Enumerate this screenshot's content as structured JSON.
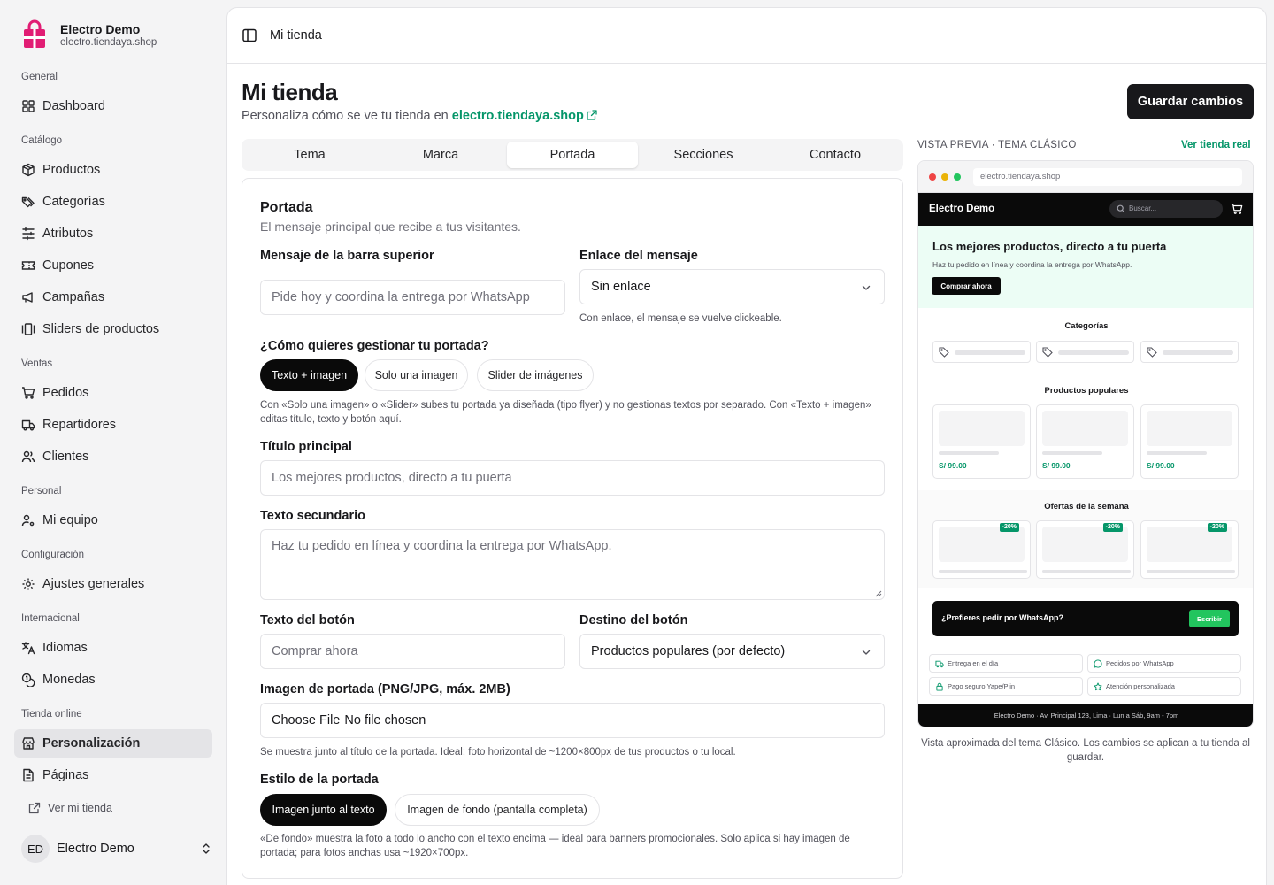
{
  "sidebar": {
    "brand": {
      "name": "Electro Demo",
      "domain": "electro.tiendaya.shop",
      "logo_color": "#e11d74"
    },
    "groups": {
      "general": "General",
      "catalogo": "Catálogo",
      "ventas": "Ventas",
      "personal": "Personal",
      "configuracion": "Configuración",
      "internacional": "Internacional",
      "tienda_online": "Tienda online"
    },
    "items": {
      "dashboard": "Dashboard",
      "productos": "Productos",
      "categorias": "Categorías",
      "atributos": "Atributos",
      "cupones": "Cupones",
      "campanas": "Campañas",
      "sliders": "Sliders de productos",
      "pedidos": "Pedidos",
      "repartidores": "Repartidores",
      "clientes": "Clientes",
      "equipo": "Mi equipo",
      "ajustes": "Ajustes generales",
      "idiomas": "Idiomas",
      "monedas": "Monedas",
      "personalizacion": "Personalización",
      "paginas": "Páginas"
    },
    "view_store": "Ver mi tienda",
    "user": {
      "initials": "ED",
      "name": "Electro Demo"
    }
  },
  "topbar": {
    "breadcrumb": "Mi tienda"
  },
  "page": {
    "title": "Mi tienda",
    "subtitle_prefix": "Personaliza cómo se ve tu tienda en",
    "subtitle_link": "electro.tiendaya.shop",
    "save_label": "Guardar cambios"
  },
  "tabs": [
    "Tema",
    "Marca",
    "Portada",
    "Secciones",
    "Contacto"
  ],
  "active_tab": "Portada",
  "form": {
    "section_title": "Portada",
    "section_desc": "El mensaje principal que recibe a tus visitantes.",
    "topbar_msg": {
      "label": "Mensaje de la barra superior",
      "placeholder": "Pide hoy y coordina la entrega por WhatsApp"
    },
    "msg_link": {
      "label": "Enlace del mensaje",
      "value": "Sin enlace",
      "help": "Con enlace, el mensaje se vuelve clickeable."
    },
    "manage": {
      "label": "¿Cómo quieres gestionar tu portada?",
      "options": [
        "Texto + imagen",
        "Solo una imagen",
        "Slider de imágenes"
      ],
      "selected": "Texto + imagen",
      "help": "Con «Solo una imagen» o «Slider» subes tu portada ya diseñada (tipo flyer) y no gestionas textos por separado. Con «Texto + imagen» editas título, texto y botón aquí."
    },
    "main_title": {
      "label": "Título principal",
      "placeholder": "Los mejores productos, directo a tu puerta"
    },
    "secondary_text": {
      "label": "Texto secundario",
      "placeholder": "Haz tu pedido en línea y coordina la entrega por WhatsApp."
    },
    "button_text": {
      "label": "Texto del botón",
      "placeholder": "Comprar ahora"
    },
    "button_dest": {
      "label": "Destino del botón",
      "value": "Productos populares (por defecto)"
    },
    "cover_image": {
      "label": "Imagen de portada (PNG/JPG, máx. 2MB)",
      "choose": "Choose File",
      "status": "No file chosen",
      "help": "Se muestra junto al título de la portada. Ideal: foto horizontal de ~1200×800px de tus productos o tu local."
    },
    "cover_style": {
      "label": "Estilo de la portada",
      "options": [
        "Imagen junto al texto",
        "Imagen de fondo (pantalla completa)"
      ],
      "selected": "Imagen junto al texto",
      "help": "«De fondo» muestra la foto a todo lo ancho con el texto encima — ideal para banners promocionales. Solo aplica si hay imagen de portada; para fotos anchas usa ~1920×700px."
    }
  },
  "preview": {
    "header": "VISTA PREVIA · TEMA CLÁSICO",
    "view_store": "Ver tienda real",
    "url": "electro.tiendaya.shop",
    "store_name": "Electro Demo",
    "search_placeholder": "Buscar...",
    "hero_title": "Los mejores productos, directo a tu puerta",
    "hero_sub": "Haz tu pedido en línea y coordina la entrega por WhatsApp.",
    "hero_button": "Comprar ahora",
    "categories_title": "Categorías",
    "popular_title": "Productos populares",
    "prices": [
      "S/ 99.00",
      "S/ 99.00",
      "S/ 99.00"
    ],
    "offers_title": "Ofertas de la semana",
    "discounts": [
      "-20%",
      "-20%",
      "-20%"
    ],
    "whatsapp_text": "¿Prefieres pedir por WhatsApp?",
    "whatsapp_button": "Escribir",
    "features": [
      "Entrega en el día",
      "Pedidos por WhatsApp",
      "Pago seguro Yape/Plin",
      "Atención personalizada"
    ],
    "footer": "Electro Demo · Av. Principal 123, Lima · Lun a Sáb, 9am - 7pm",
    "caption": "Vista aproximada del tema Clásico. Los cambios se aplican a tu tienda al guardar."
  },
  "colors": {
    "accent": "#059669",
    "dark": "#0a0a0a",
    "whatsapp": "#22c55e",
    "hero_bg": "#ecfdf5"
  }
}
